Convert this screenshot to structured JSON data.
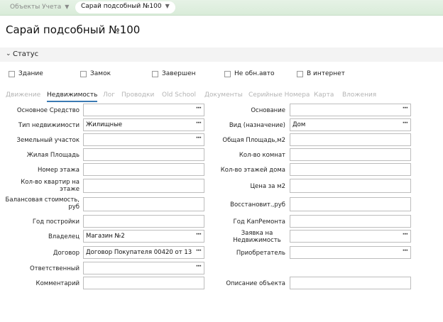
{
  "breadcrumb": {
    "parent": "Объекты Учета",
    "current": "Сарай подсобный №100"
  },
  "page": {
    "title": "Сарай подсобный №100"
  },
  "status_section": {
    "label": "Статус"
  },
  "checkboxes": [
    {
      "label": "Здание",
      "checked": false
    },
    {
      "label": "Замок",
      "checked": false
    },
    {
      "label": "Завершен",
      "checked": false
    },
    {
      "label": "Не обн.авто",
      "checked": false
    },
    {
      "label": "В интернет",
      "checked": false
    }
  ],
  "tabs": [
    {
      "label": "Движение",
      "active": false
    },
    {
      "label": "Недвижимость",
      "active": true
    },
    {
      "label": "Лог",
      "active": false
    },
    {
      "label": "Проводки",
      "active": false
    },
    {
      "label": "Old School",
      "active": false
    },
    {
      "label": "Документы",
      "active": false
    },
    {
      "label": "Серийные Номера",
      "active": false
    },
    {
      "label": "Карта",
      "active": false
    },
    {
      "label": "Вложения",
      "active": false
    }
  ],
  "form": {
    "left": [
      {
        "label": "Основное Средство",
        "value": "",
        "lookup": true
      },
      {
        "label": "Тип недвижимости",
        "value": "Жилищные",
        "lookup": true
      },
      {
        "label": "Земельный участок",
        "value": "",
        "lookup": true
      },
      {
        "label": "Жилая Площадь",
        "value": "",
        "lookup": false
      },
      {
        "label": "Номер этажа",
        "value": "",
        "lookup": false
      },
      {
        "label": "Кол-во квартир на этаже",
        "value": "",
        "lookup": false
      },
      {
        "label": "Балансовая стоимость, руб",
        "value": "",
        "lookup": false
      },
      {
        "label": "Год постройки",
        "value": "",
        "lookup": false
      },
      {
        "label": "Владелец",
        "value": "Магазин №2",
        "lookup": true
      },
      {
        "label": "Договор",
        "value": "Договор Покупателя 00420 от 13",
        "lookup": true
      },
      {
        "label": "Ответственный",
        "value": "",
        "lookup": true
      },
      {
        "label": "Комментарий",
        "value": "",
        "lookup": false
      }
    ],
    "right": [
      {
        "label": "Основание",
        "value": "",
        "lookup": true
      },
      {
        "label": "Вид (назначение)",
        "value": "Дом",
        "lookup": true
      },
      {
        "label": "Общая Площадь,м2",
        "value": "",
        "lookup": false
      },
      {
        "label": "Кол-во комнат",
        "value": "",
        "lookup": false
      },
      {
        "label": "Кол-во этажей дома",
        "value": "",
        "lookup": false
      },
      {
        "label": "Цена за м2",
        "value": "",
        "lookup": false
      },
      {
        "label": "Восстановит.,руб",
        "value": "",
        "lookup": false
      },
      {
        "label": "Год КапРемонта",
        "value": "",
        "lookup": false
      },
      {
        "label": "Заявка на Недвижимость",
        "value": "",
        "lookup": true
      },
      {
        "label": "Приобретатель",
        "value": "",
        "lookup": true
      },
      {
        "label": "Описание объекта",
        "value": "",
        "lookup": false
      }
    ],
    "lookup_button": "···"
  }
}
